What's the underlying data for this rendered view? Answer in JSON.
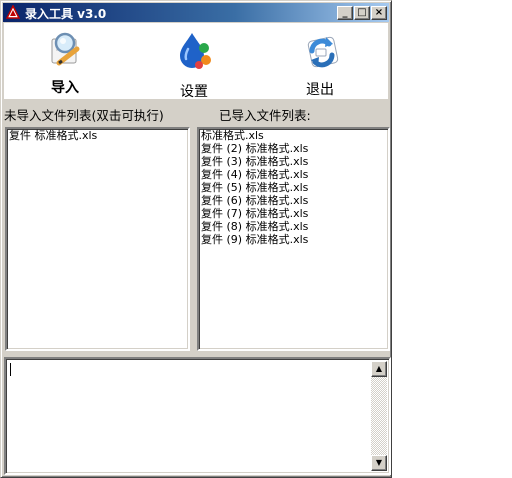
{
  "window": {
    "title": "录入工具  v3.0",
    "controls": {
      "minimize": "_",
      "maximize": "□",
      "close": "×"
    }
  },
  "toolbar": {
    "import_label": "导入",
    "settings_label": "设置",
    "exit_label": "退出"
  },
  "labels": {
    "not_imported": "未导入文件列表(双击可执行)",
    "imported": "已导入文件列表:"
  },
  "not_imported_files": [
    "复件 标准格式.xls"
  ],
  "imported_files": [
    "标准格式.xls",
    "复件 (2) 标准格式.xls",
    "复件 (3) 标准格式.xls",
    "复件 (4) 标准格式.xls",
    "复件 (5) 标准格式.xls",
    "复件 (6) 标准格式.xls",
    "复件 (7) 标准格式.xls",
    "复件 (8) 标准格式.xls",
    "复件 (9) 标准格式.xls"
  ],
  "memo": {
    "value": ""
  },
  "icons": {
    "title": "app-icon",
    "import": "magnifier-pencil-icon",
    "settings": "drops-settings-icon",
    "exit": "refresh-arrow-icon"
  }
}
